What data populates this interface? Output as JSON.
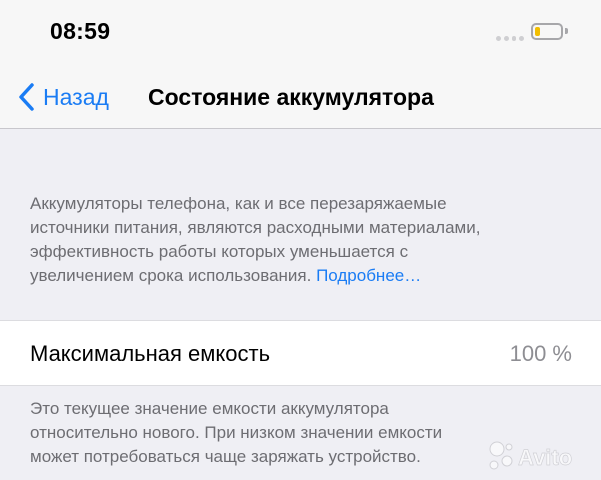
{
  "status_bar": {
    "time": "08:59",
    "signal_icon": "cellular-signal-icon",
    "battery_icon": "battery-icon",
    "battery_level_fraction": 0.2,
    "battery_color": "#f2be00"
  },
  "nav": {
    "back_icon": "chevron-left-icon",
    "back_label": "Назад",
    "title": "Состояние аккумулятора"
  },
  "description": {
    "line1": "Аккумуляторы телефона, как и все перезаряжаемые",
    "line2": "источники питания, являются расходными материалами,",
    "line3": "эффективность работы которых уменьшается с",
    "line4_text": "увеличением срока использования. ",
    "learn_more": "Подробнее…"
  },
  "capacity": {
    "label": "Максимальная емкость",
    "value": "100 %"
  },
  "footnote": {
    "line1": "Это текущее значение емкости аккумулятора",
    "line2": "относительно нового. При низком значении емкости",
    "line3": "может потребоваться чаще заряжать устройство."
  },
  "watermark": {
    "text": "Avito"
  },
  "colors": {
    "accent": "#1a7cf4",
    "background": "#efeff4",
    "secondary_text": "#6d6d72",
    "value_text": "#8e8e93"
  }
}
